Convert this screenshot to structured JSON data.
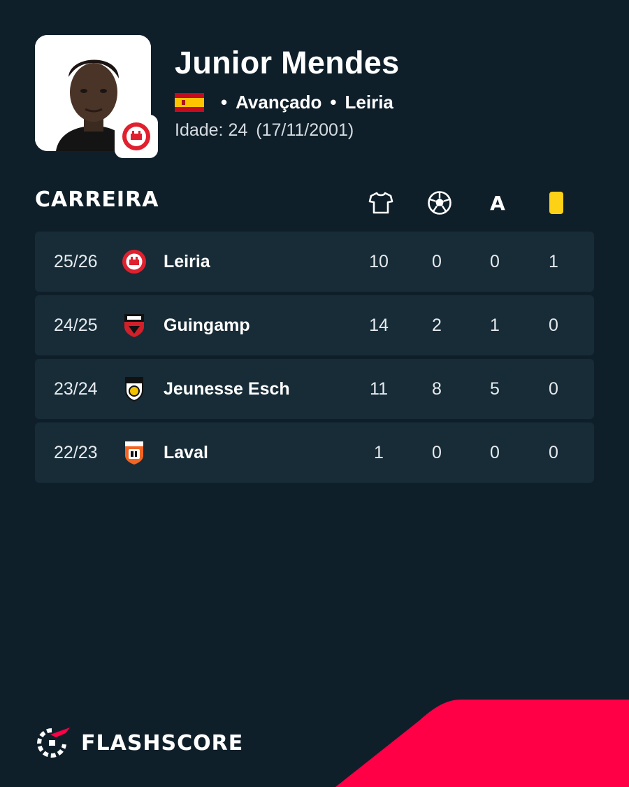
{
  "player": {
    "name": "Junior Mendes",
    "position": "Avançado",
    "club": "Leiria",
    "age_label": "Idade: 24",
    "birthdate": "(17/11/2001)"
  },
  "career": {
    "title": "CARREIRA",
    "column_icons": [
      "shirt-icon",
      "ball-icon",
      "assist-icon",
      "yellow-card-icon"
    ],
    "assist_letter": "A",
    "rows": [
      {
        "season": "25/26",
        "club": "Leiria",
        "apps": "10",
        "goals": "0",
        "assists": "0",
        "yellow": "1"
      },
      {
        "season": "24/25",
        "club": "Guingamp",
        "apps": "14",
        "goals": "2",
        "assists": "1",
        "yellow": "0"
      },
      {
        "season": "23/24",
        "club": "Jeunesse Esch",
        "apps": "11",
        "goals": "8",
        "assists": "5",
        "yellow": "0"
      },
      {
        "season": "22/23",
        "club": "Laval",
        "apps": "1",
        "goals": "0",
        "assists": "0",
        "yellow": "0"
      }
    ]
  },
  "brand": {
    "name": "FLASHSCORE"
  },
  "colors": {
    "background": "#0f1f2a",
    "row": "#172c37",
    "accent": "#ff0046",
    "yellow_card": "#fcd116"
  }
}
